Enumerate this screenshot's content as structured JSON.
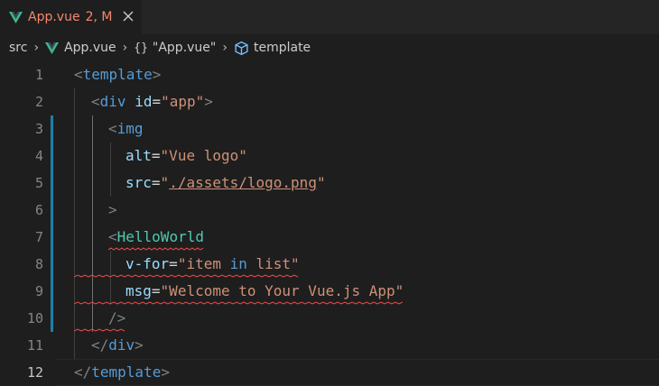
{
  "tab": {
    "file_name": "App.vue",
    "status": "2, M",
    "icon": "vue-icon",
    "close_icon": "close-icon",
    "colors": {
      "modified_text": "#f48771",
      "vue_green": "#41b883",
      "vue_dark": "#35495e"
    }
  },
  "breadcrumb": {
    "items": [
      "src",
      "App.vue",
      "\"App.vue\"",
      "template"
    ],
    "separator": "›",
    "object_glyph": "{}"
  },
  "editor": {
    "active_line": 12,
    "line_numbers": [
      "1",
      "2",
      "3",
      "4",
      "5",
      "6",
      "7",
      "8",
      "9",
      "10",
      "11",
      "12"
    ],
    "lines": [
      {
        "parts": [
          "<",
          "template",
          ">"
        ]
      },
      {
        "parts": [
          "<",
          "div",
          " ",
          "id",
          "=",
          "\"app\"",
          ">"
        ]
      },
      {
        "parts": [
          "<",
          "img"
        ]
      },
      {
        "parts": [
          "alt",
          "=",
          "\"Vue logo\""
        ]
      },
      {
        "parts": [
          "src",
          "=",
          "\"",
          "./assets/logo.png",
          "\""
        ]
      },
      {
        "parts": [
          ">"
        ]
      },
      {
        "parts": [
          "<",
          "HelloWorld"
        ]
      },
      {
        "parts": [
          "v-for",
          "=",
          "\"item ",
          "in",
          " list\""
        ]
      },
      {
        "parts": [
          "msg",
          "=",
          "\"Welcome to Your Vue.js App\""
        ]
      },
      {
        "parts": [
          "/>"
        ]
      },
      {
        "parts": [
          "</",
          "div",
          ">"
        ]
      },
      {
        "parts": [
          "</",
          "template",
          ">"
        ]
      }
    ]
  }
}
